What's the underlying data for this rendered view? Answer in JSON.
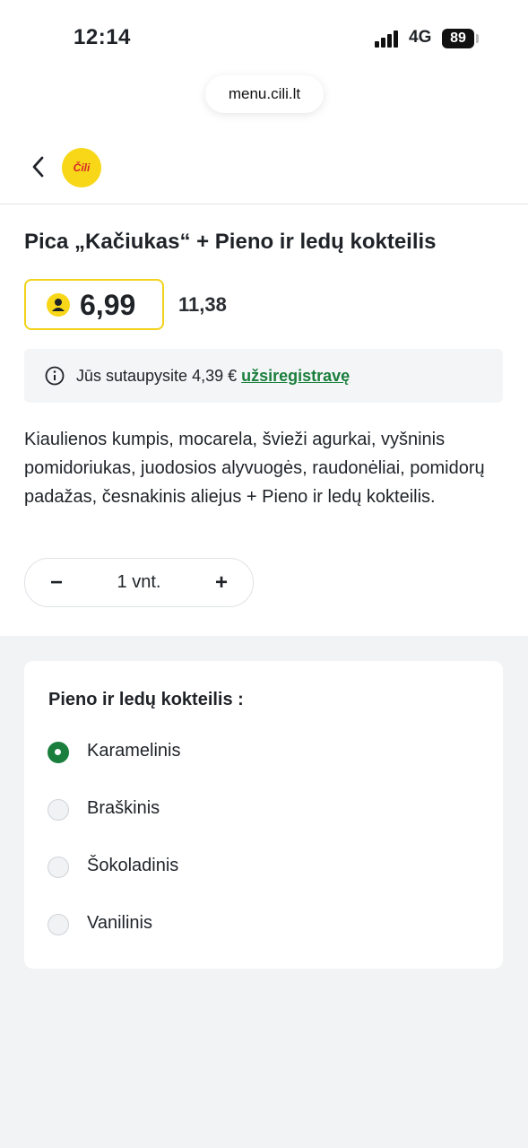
{
  "status": {
    "time": "12:14",
    "network": "4G",
    "battery": "89"
  },
  "browser": {
    "url": "menu.cili.lt"
  },
  "header": {
    "back_icon": "chevron-left-icon",
    "logo_text": "Čili"
  },
  "product": {
    "title": "Pica „Kačiukas“ + Pieno ir ledų kokteilis",
    "price": "6,99",
    "old_price": "11,38",
    "savings_text": "Jūs sutaupysite 4,39 € ",
    "savings_link": "užsiregistravę",
    "description": "Kiaulienos kumpis, mocarela, švieži agurkai, vyšninis pomidoriukas, juodosios alyvuogės, raudonėliai, pomi­dorų padažas, česnakinis aliejus + Pieno ir ledų kok­teilis.",
    "quantity": {
      "minus": "−",
      "value": "1 vnt.",
      "plus": "+"
    }
  },
  "options": {
    "title": "Pieno ir ledų kokteilis :",
    "items": [
      {
        "label": "Karamelinis",
        "selected": true
      },
      {
        "label": "Braškinis",
        "selected": false
      },
      {
        "label": "Šokoladinis",
        "selected": false
      },
      {
        "label": "Vanilinis",
        "selected": false
      }
    ]
  },
  "colors": {
    "accent_green": "#1a7f3c",
    "brand_yellow": "#f7d718"
  }
}
